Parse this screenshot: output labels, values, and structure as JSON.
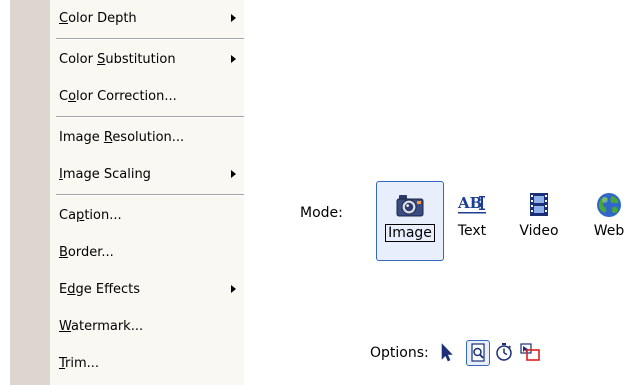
{
  "menu": {
    "items": [
      {
        "pre": "",
        "acc": "C",
        "post": "olor Depth",
        "submenu": true
      },
      {
        "pre": "Color ",
        "acc": "S",
        "post": "ubstitution",
        "submenu": true
      },
      {
        "pre": "C",
        "acc": "o",
        "post": "lor Correction...",
        "submenu": false
      },
      {
        "pre": "Image ",
        "acc": "R",
        "post": "esolution...",
        "submenu": false
      },
      {
        "pre": "",
        "acc": "I",
        "post": "mage Scaling",
        "submenu": true
      },
      {
        "pre": "Ca",
        "acc": "p",
        "post": "tion...",
        "submenu": false
      },
      {
        "pre": "",
        "acc": "B",
        "post": "order...",
        "submenu": false
      },
      {
        "pre": "E",
        "acc": "d",
        "post": "ge Effects",
        "submenu": true
      },
      {
        "pre": "",
        "acc": "W",
        "post": "atermark...",
        "submenu": false
      },
      {
        "pre": "",
        "acc": "T",
        "post": "rim...",
        "submenu": false
      }
    ]
  },
  "mode": {
    "label": "Mode:",
    "buttons": [
      {
        "label": "Image",
        "icon": "camera-icon",
        "selected": true
      },
      {
        "label": "Text",
        "icon": "abi-text-icon",
        "selected": false
      },
      {
        "label": "Video",
        "icon": "film-icon",
        "selected": false
      },
      {
        "label": "Web",
        "icon": "globe-icon",
        "selected": false
      }
    ]
  },
  "options": {
    "label": "Options:",
    "buttons": [
      {
        "icon": "cursor-icon",
        "selected": false
      },
      {
        "icon": "page-magnify-icon",
        "selected": true
      },
      {
        "icon": "timer-icon",
        "selected": false
      },
      {
        "icon": "region-icon",
        "selected": false
      }
    ]
  },
  "colors": {
    "selection_border": "#3468c0",
    "selection_fill": "#e8eefb",
    "menu_background": "#f9f8f3",
    "menu_strip": "#dcd5d0",
    "region_red": "#e02020"
  }
}
